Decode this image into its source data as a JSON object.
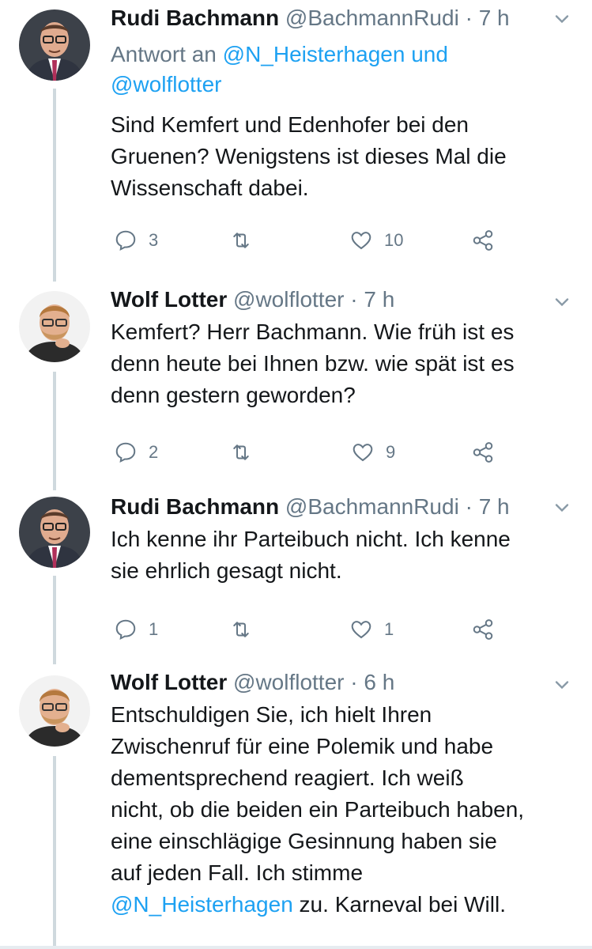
{
  "tweets": [
    {
      "name": "Rudi Bachmann",
      "handle": "@BachmannRudi",
      "separator": "·",
      "time": "7 h",
      "avatar": "avatar-man-glasses-tie",
      "reply_prefix": "Antwort an",
      "reply_mention_1": "@N_Heisterhagen",
      "reply_joiner": "und",
      "reply_mention_2": "@wolflotter",
      "text_lines": [
        "Sind Kemfert und Edenhofer bei den",
        "Gruenen? Wenigstens ist dieses Mal die",
        "Wissenschaft dabei."
      ],
      "replies": "3",
      "retweets": "",
      "likes": "10"
    },
    {
      "name": "Wolf Lotter",
      "handle": "@wolflotter",
      "separator": "·",
      "time": "7 h",
      "avatar": "avatar-man-beard-glasses",
      "text_lines": [
        "Kemfert? Herr Bachmann. Wie früh ist es",
        "denn heute bei Ihnen bzw. wie spät ist es",
        "denn gestern geworden?"
      ],
      "replies": "2",
      "retweets": "",
      "likes": "9"
    },
    {
      "name": "Rudi Bachmann",
      "handle": "@BachmannRudi",
      "separator": "·",
      "time": "7 h",
      "avatar": "avatar-man-glasses-tie",
      "text_lines": [
        "Ich kenne ihr Parteibuch nicht. Ich kenne",
        "sie ehrlich gesagt nicht."
      ],
      "replies": "1",
      "retweets": "",
      "likes": "1"
    },
    {
      "name": "Wolf Lotter",
      "handle": "@wolflotter",
      "separator": "·",
      "time": "6 h",
      "avatar": "avatar-man-beard-glasses",
      "text_lines": [
        "Entschuldigen Sie, ich hielt Ihren",
        "Zwischenruf für eine Polemik und habe",
        "dementsprechend reagiert. Ich weiß",
        "nicht, ob die beiden ein Parteibuch haben,",
        "eine einschlägige Gesinnung haben sie",
        "auf jeden Fall. Ich stimme"
      ],
      "last_mention": "@N_Heisterhagen",
      "last_text": " zu. Karneval bei Will."
    }
  ],
  "colors": {
    "link": "#1da1f2",
    "muted": "#657786",
    "text": "#14171a",
    "thread": "#cfd9de"
  }
}
